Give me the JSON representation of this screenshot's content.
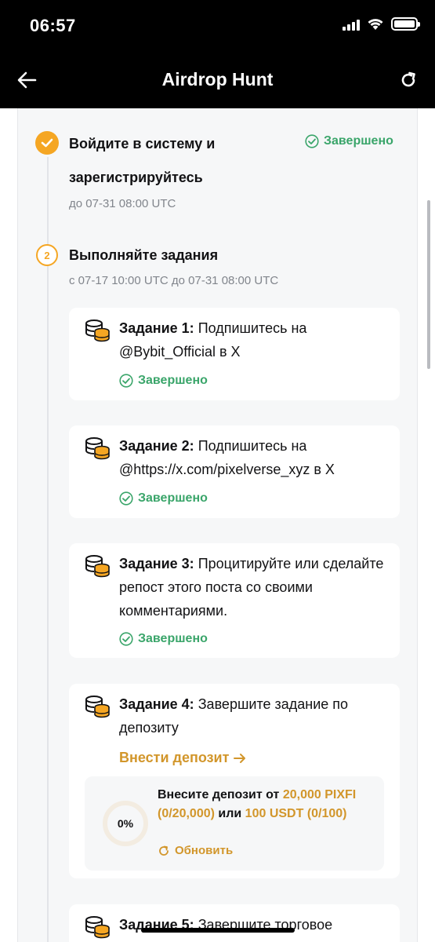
{
  "status_bar": {
    "time": "06:57"
  },
  "header": {
    "title": "Airdrop Hunt"
  },
  "steps": [
    {
      "title_line1": "Войдите в систему и",
      "title_line2": "зарегистрируйтесь",
      "date": "до 07-31 08:00 UTC",
      "status": "Завершено"
    },
    {
      "number": "2",
      "title": "Выполняйте задания",
      "date": "с 07-17 10:00 UTC до 07-31 08:00 UTC"
    }
  ],
  "tasks": [
    {
      "label": "Задание 1:",
      "text": " Подпишитесь на @Bybit_Official в X",
      "status": "Завершено"
    },
    {
      "label": "Задание 2:",
      "text": " Подпишитесь на @https://x.com/pixelverse_xyz в X",
      "status": "Завершено"
    },
    {
      "label": "Задание 3:",
      "text": " Процитируйте или сделайте репост этого поста со своими комментариями.",
      "status": "Завершено"
    },
    {
      "label": "Задание 4:",
      "text": " Завершите задание по депозиту",
      "deposit_link": "Внести депозит",
      "deposit": {
        "progress_label": "0%",
        "progress_value": 0,
        "prefix": "Внесите депозит от ",
        "amount1": "20,000 PIXFI (0/20,000)",
        "mid": " или ",
        "amount2": "100 USDT (0/100)",
        "update_label": "Обновить"
      }
    },
    {
      "label": "Задание 5:",
      "text": " Завершите торговое"
    }
  ],
  "colors": {
    "accent": "#f5a623",
    "link": "#d2962b",
    "success": "#3aa56a"
  }
}
